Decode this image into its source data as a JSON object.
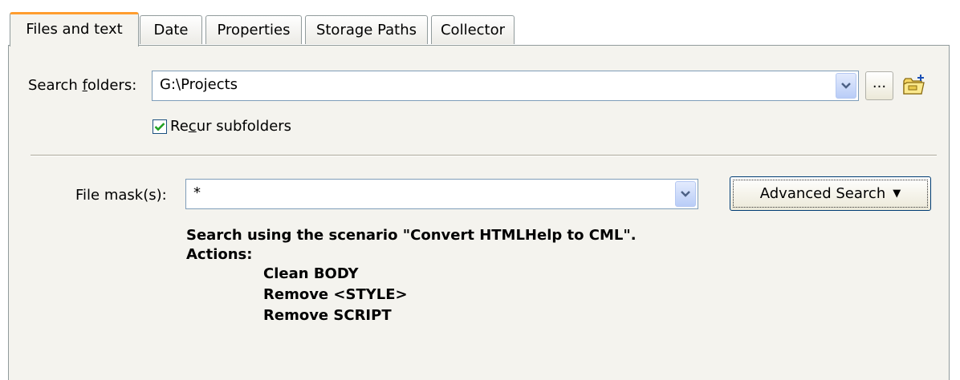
{
  "tabs": [
    {
      "label": "Files and text",
      "active": true
    },
    {
      "label": "Date"
    },
    {
      "label": "Properties"
    },
    {
      "label": "Storage Paths"
    },
    {
      "label": "Collector"
    }
  ],
  "search_folders": {
    "label_pre": "Search ",
    "label_mnemonic": "f",
    "label_post": "olders:",
    "value": "G:\\Projects",
    "browse_label": "..."
  },
  "recur": {
    "label_pre": "Re",
    "label_mnemonic": "c",
    "label_post": "ur subfolders",
    "checked": true
  },
  "file_mask": {
    "label": "File mask(s):",
    "value": "*"
  },
  "advanced_search": {
    "label": "Advanced Search",
    "arrow": "▼"
  },
  "scenario": {
    "line1": "Search using the scenario \"Convert HTMLHelp to CML\".",
    "actions_label": "Actions:",
    "actions": [
      "Clean BODY",
      "Remove <STYLE>",
      "Remove SCRIPT"
    ]
  },
  "colors": {
    "active_tab_accent": "#ff9d2e",
    "check_green": "#21a121",
    "panel_bg": "#f4f3ee"
  },
  "icons": [
    "chevron-down-icon",
    "folder-add-icon",
    "checkmark-icon"
  ]
}
